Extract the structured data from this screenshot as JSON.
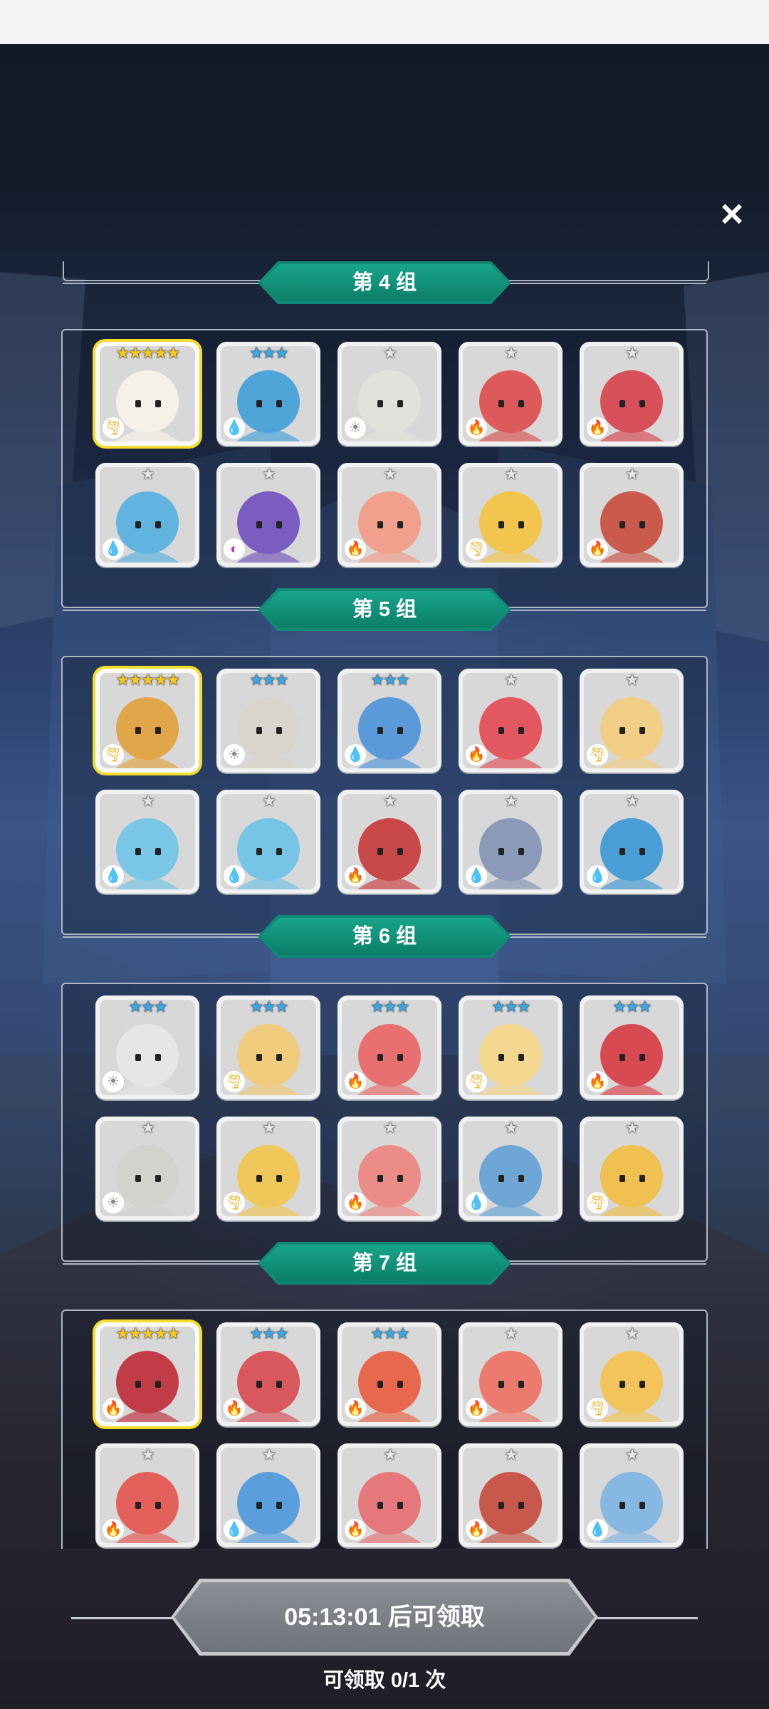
{
  "close_icon": "×",
  "icons": {
    "close": "close-icon",
    "star": "star-icon"
  },
  "colors": {
    "ribbon": "#0f8a74",
    "gold_star": "#f7c81e",
    "blue_star": "#3aa7e8",
    "silver_star": "#e6e6e6"
  },
  "groups": [
    {
      "title": "第 4 组",
      "heroes": [
        {
          "stars": 5,
          "element": "wind",
          "face": "#f6f1e8"
        },
        {
          "stars": 3,
          "element": "water",
          "face": "#4fa4d8"
        },
        {
          "stars": 1,
          "element": "light",
          "face": "#e2e2dc"
        },
        {
          "stars": 1,
          "element": "fire",
          "face": "#dc5a5a"
        },
        {
          "stars": 1,
          "element": "fire",
          "face": "#d8505a"
        },
        {
          "stars": 1,
          "element": "water",
          "face": "#62b3e0"
        },
        {
          "stars": 1,
          "element": "dark",
          "face": "#7b5cc0"
        },
        {
          "stars": 1,
          "element": "fire",
          "face": "#f0a08c"
        },
        {
          "stars": 1,
          "element": "wind",
          "face": "#f2c64e"
        },
        {
          "stars": 1,
          "element": "fire",
          "face": "#c95a4c"
        }
      ]
    },
    {
      "title": "第 5 组",
      "heroes": [
        {
          "stars": 5,
          "element": "wind",
          "face": "#e2a64a"
        },
        {
          "stars": 3,
          "element": "light",
          "face": "#d8d6cc"
        },
        {
          "stars": 3,
          "element": "water",
          "face": "#5a9ad8"
        },
        {
          "stars": 1,
          "element": "fire",
          "face": "#e35860"
        },
        {
          "stars": 1,
          "element": "wind",
          "face": "#f2cf86"
        },
        {
          "stars": 1,
          "element": "water",
          "face": "#79c6e6"
        },
        {
          "stars": 1,
          "element": "water",
          "face": "#76c4e6"
        },
        {
          "stars": 1,
          "element": "fire",
          "face": "#c94848"
        },
        {
          "stars": 1,
          "element": "water",
          "face": "#8a9ab8"
        },
        {
          "stars": 1,
          "element": "water",
          "face": "#4a9ed6"
        }
      ]
    },
    {
      "title": "第 6 组",
      "heroes": [
        {
          "stars": 3,
          "element": "light",
          "face": "#e6e6e6"
        },
        {
          "stars": 3,
          "element": "wind",
          "face": "#f0cc7c"
        },
        {
          "stars": 3,
          "element": "fire",
          "face": "#e87070"
        },
        {
          "stars": 3,
          "element": "wind",
          "face": "#f4d890"
        },
        {
          "stars": 3,
          "element": "fire",
          "face": "#d84a52"
        },
        {
          "stars": 1,
          "element": "light",
          "face": "#d4d2ce"
        },
        {
          "stars": 1,
          "element": "wind",
          "face": "#f0c85a"
        },
        {
          "stars": 1,
          "element": "fire",
          "face": "#ec8c88"
        },
        {
          "stars": 1,
          "element": "water",
          "face": "#6ea6d6"
        },
        {
          "stars": 1,
          "element": "wind",
          "face": "#f0c050"
        }
      ]
    },
    {
      "title": "第 7 组",
      "heroes": [
        {
          "stars": 5,
          "element": "fire",
          "face": "#c23c48"
        },
        {
          "stars": 3,
          "element": "fire",
          "face": "#d8585e"
        },
        {
          "stars": 3,
          "element": "fire",
          "face": "#e8684e"
        },
        {
          "stars": 1,
          "element": "fire",
          "face": "#ec7a6e"
        },
        {
          "stars": 1,
          "element": "wind",
          "face": "#f2c45a"
        },
        {
          "stars": 1,
          "element": "fire",
          "face": "#e4605a"
        },
        {
          "stars": 1,
          "element": "water",
          "face": "#5a9edc"
        },
        {
          "stars": 1,
          "element": "fire",
          "face": "#e4787a"
        },
        {
          "stars": 1,
          "element": "fire",
          "face": "#c8584c"
        },
        {
          "stars": 1,
          "element": "water",
          "face": "#86b8e2"
        }
      ]
    }
  ],
  "footer": {
    "claim_button": "05:13:01 后可领取",
    "claim_count": "可领取 0/1 次"
  }
}
